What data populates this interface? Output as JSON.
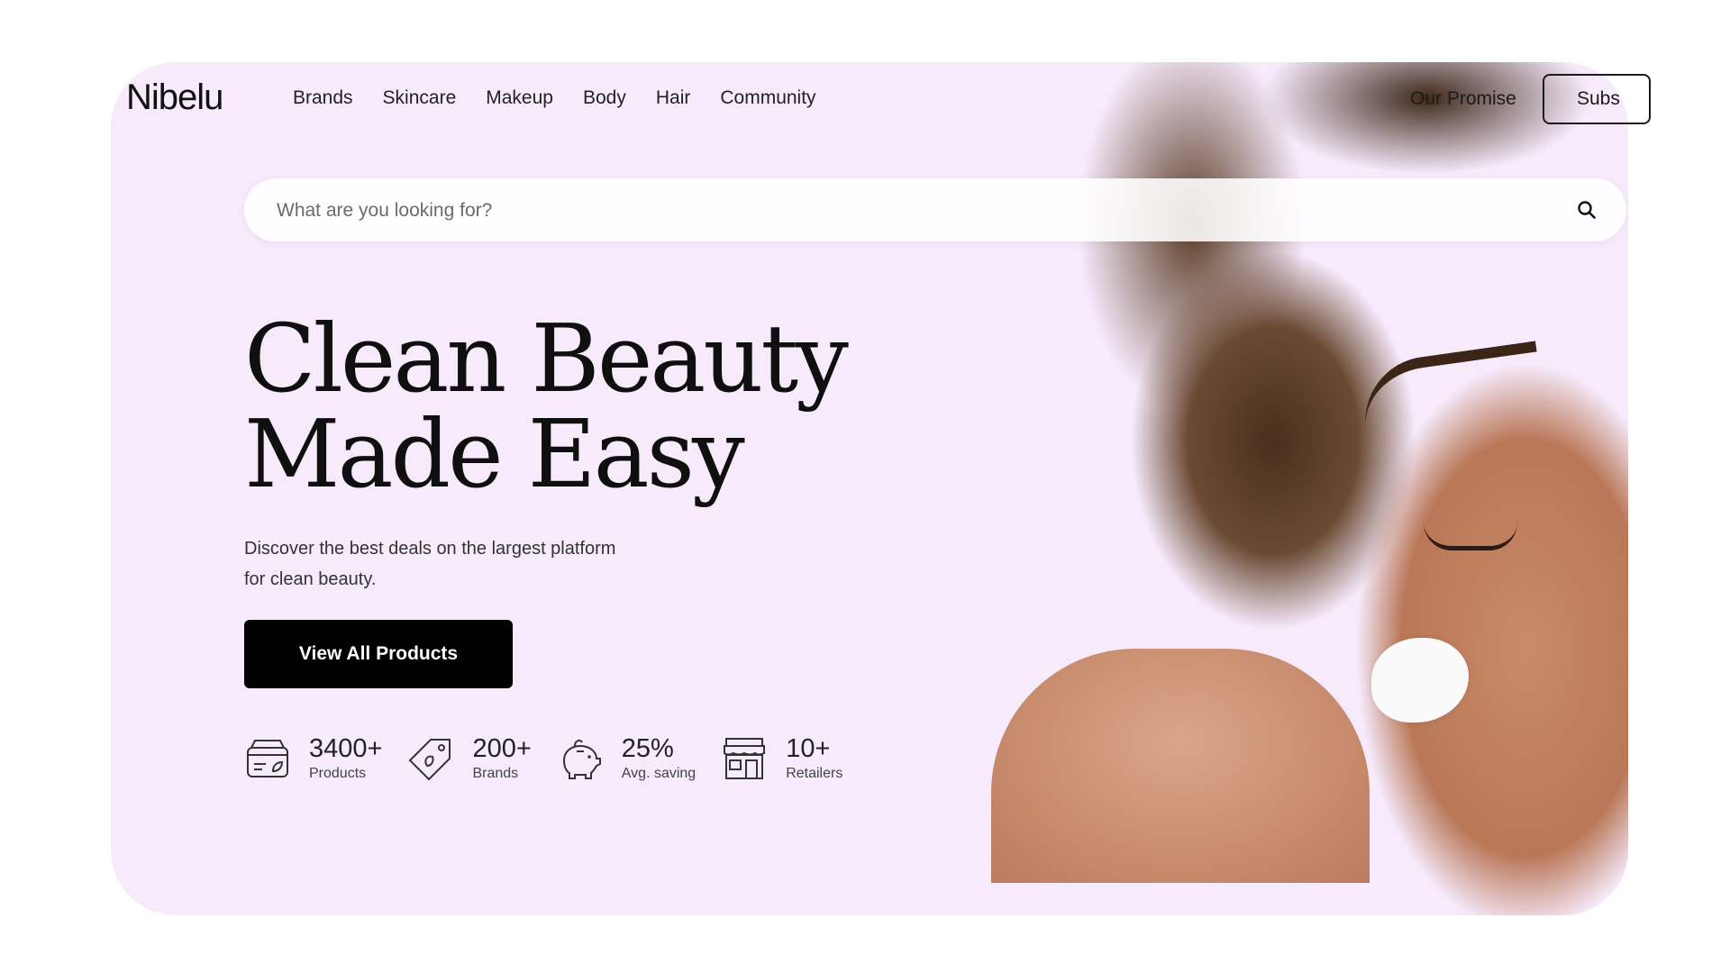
{
  "brand": {
    "logo_text": "Nibelu"
  },
  "nav": {
    "items": [
      {
        "label": "Brands"
      },
      {
        "label": "Skincare"
      },
      {
        "label": "Makeup"
      },
      {
        "label": "Body"
      },
      {
        "label": "Hair"
      },
      {
        "label": "Community"
      }
    ],
    "promise_label": "Our Promise",
    "subscribe_label": "Subs"
  },
  "search": {
    "placeholder": "What are you looking for?",
    "icon": "search-icon"
  },
  "hero": {
    "headline_line1": "Clean Beauty",
    "headline_line2": "Made Easy",
    "subtitle": "Discover the best deals on the largest platform for clean beauty.",
    "cta_label": "View All Products"
  },
  "stats": [
    {
      "value": "3400+",
      "label": "Products",
      "icon": "product-jar-icon"
    },
    {
      "value": "200+",
      "label": "Brands",
      "icon": "tag-icon"
    },
    {
      "value": "25%",
      "label": "Avg. saving",
      "icon": "piggy-bank-icon"
    },
    {
      "value": "10+",
      "label": "Retailers",
      "icon": "storefront-icon"
    }
  ],
  "colors": {
    "background": "#f6eafb",
    "text": "#111111",
    "cta_bg": "#000000",
    "cta_text": "#ffffff"
  }
}
